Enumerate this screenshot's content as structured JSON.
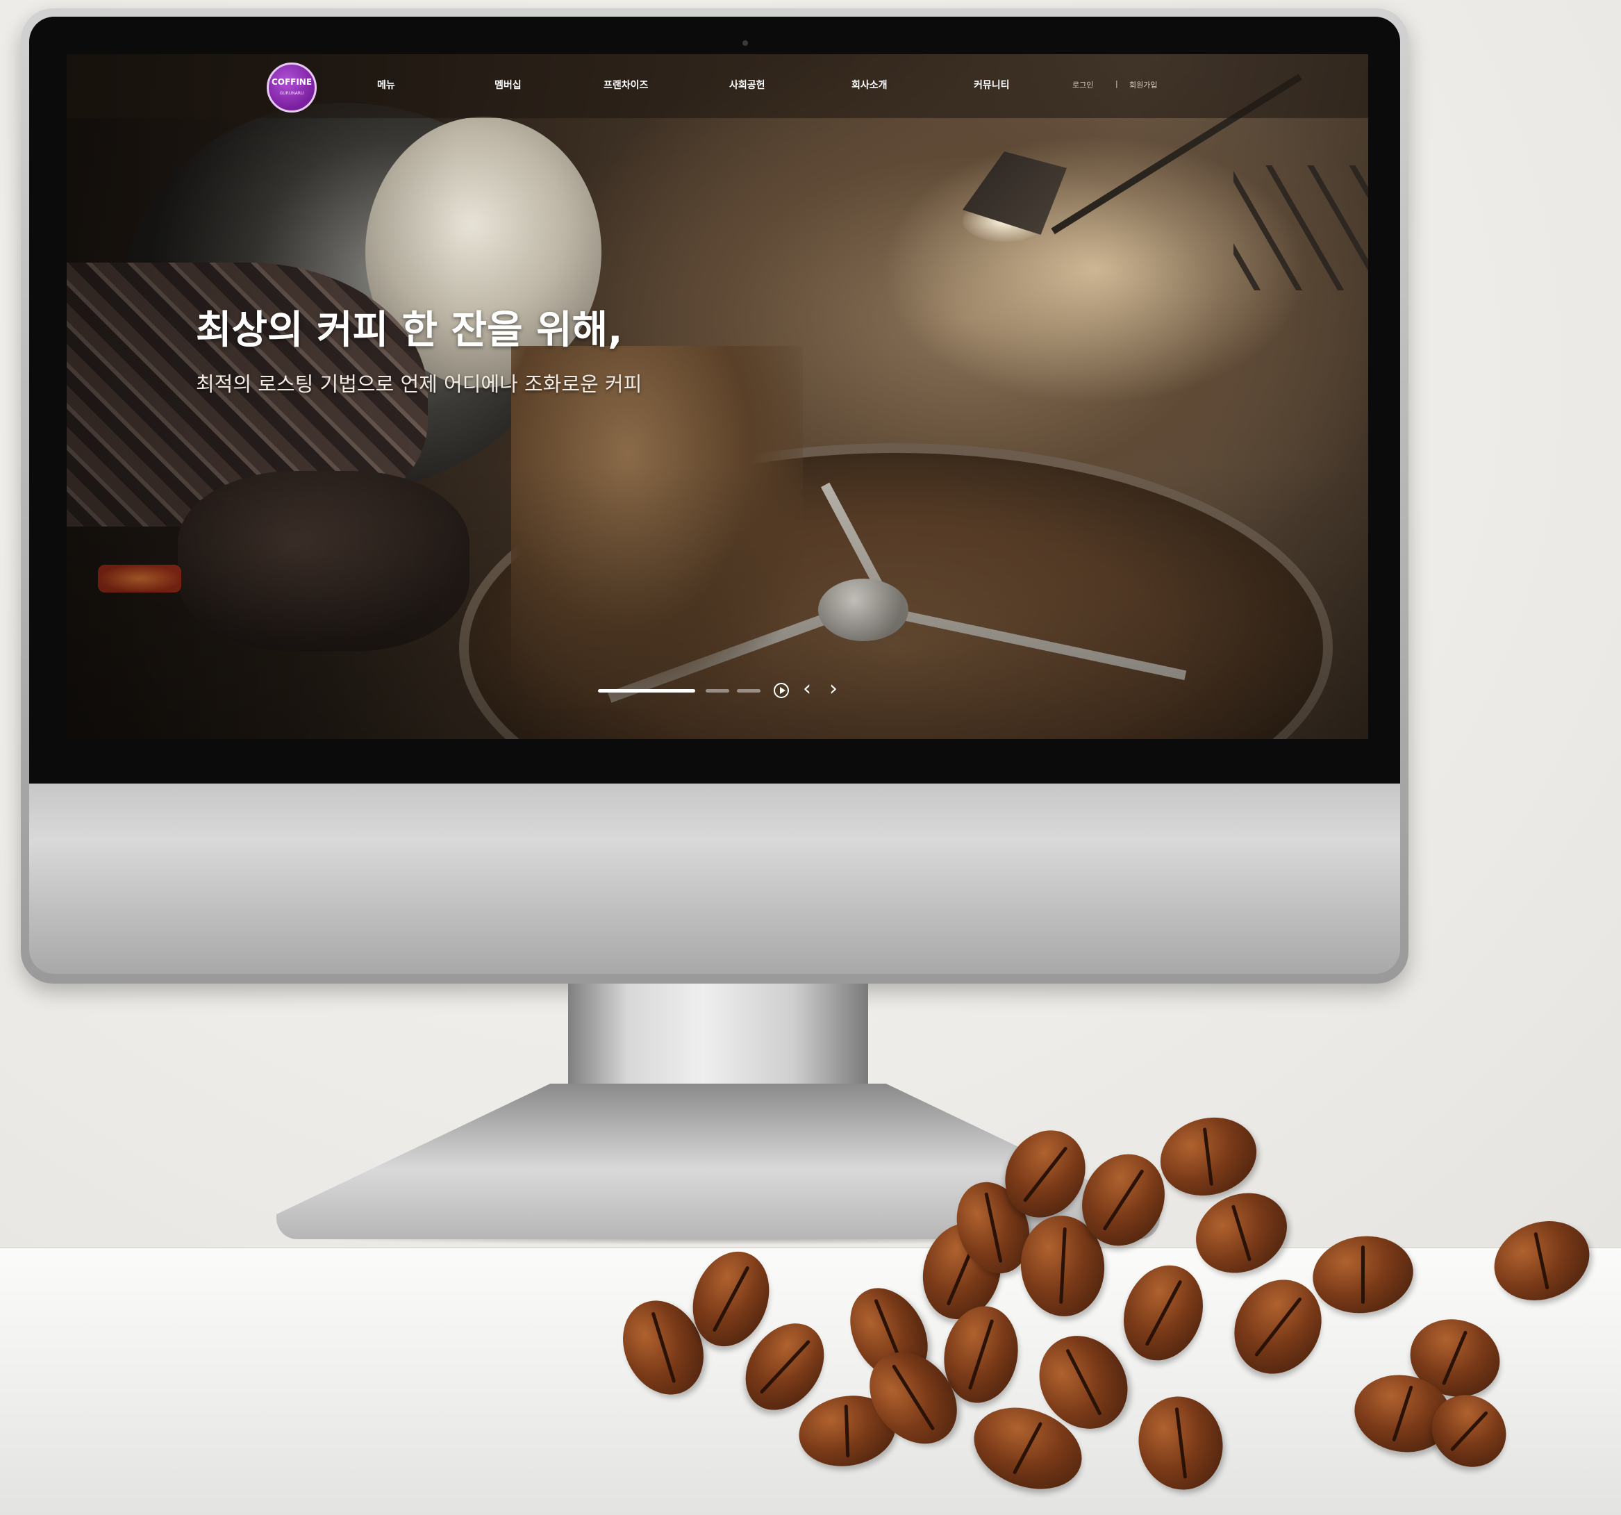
{
  "nav": {
    "logo_text": "COFFINE",
    "logo_sub": "GURUNARU",
    "items": [
      "메뉴",
      "멤버십",
      "프랜차이즈",
      "사회공헌",
      "회사소개",
      "커뮤니티"
    ],
    "login": "로그인",
    "separator": "|",
    "signup": "회원가입"
  },
  "hero": {
    "title": "최상의 커피 한 잔을 위해,",
    "subtitle": "최적의 로스팅 기법으로 언제 어디에나 조화로운 커피"
  },
  "slider": {
    "total_slides": 3,
    "active_slide": 1,
    "prev_glyph": "‹",
    "next_glyph": "›"
  },
  "colors": {
    "logo_purple": "#7a1f9e",
    "nav_text": "#ffffff"
  }
}
